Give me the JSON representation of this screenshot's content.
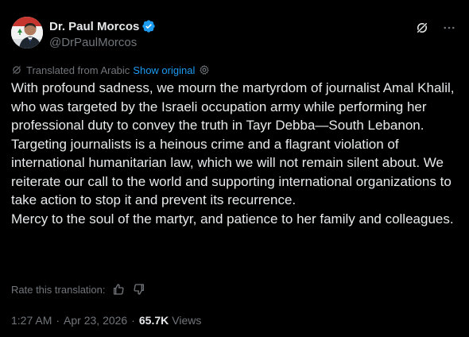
{
  "author": {
    "display_name": "Dr. Paul Morcos",
    "handle": "@DrPaulMorcos",
    "verified": true,
    "verified_color": "#1d9bf0"
  },
  "header_actions": {
    "grok_icon": "grok-icon",
    "more_icon": "more-horizontal-icon"
  },
  "translation": {
    "label": "Translated from Arabic",
    "show_original": "Show original",
    "rate_label": "Rate this translation:"
  },
  "tweet": {
    "text": "With profound sadness, we mourn the martyrdom of journalist Amal Khalil, who was targeted by the Israeli occupation army while performing her professional duty to convey the truth in Tayr Debba—South Lebanon.\nTargeting journalists is a heinous crime and a flagrant violation of international humanitarian law, which we will not remain silent about. We reiterate our call to the world and supporting international organizations to take action to stop it and prevent its recurrence.\nMercy to the soul of the martyr, and patience to her family and colleagues."
  },
  "meta": {
    "time": "1:27 AM",
    "separator": "·",
    "date": "Apr 23, 2026",
    "views_count": "65.7K",
    "views_label": "Views"
  },
  "colors": {
    "background": "#000000",
    "text": "#e7e9ea",
    "secondary": "#71767b",
    "link": "#1d9bf0"
  }
}
